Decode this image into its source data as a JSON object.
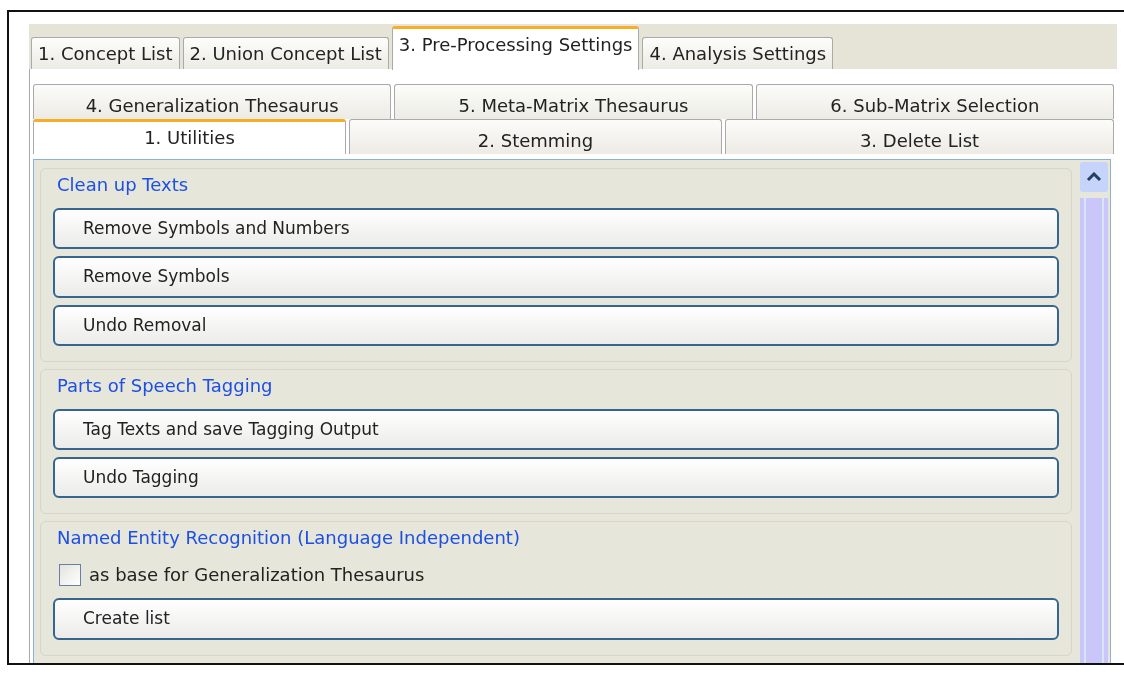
{
  "tabs": [
    {
      "label": "1. Concept List",
      "selected": false
    },
    {
      "label": "2. Union Concept List",
      "selected": false
    },
    {
      "label": "3. Pre-Processing Settings",
      "selected": true
    },
    {
      "label": "4. Analysis Settings",
      "selected": false
    }
  ],
  "subtab_rows": [
    [
      {
        "label": "4. Generalization Thesaurus",
        "selected": false
      },
      {
        "label": "5. Meta-Matrix Thesaurus",
        "selected": false
      },
      {
        "label": "6. Sub-Matrix Selection",
        "selected": false
      }
    ],
    [
      {
        "label": "1. Utilities",
        "selected": true
      },
      {
        "label": "2. Stemming",
        "selected": false
      },
      {
        "label": "3. Delete List",
        "selected": false
      }
    ]
  ],
  "groups": [
    {
      "title": "Clean up Texts",
      "items": [
        {
          "kind": "button",
          "label": "Remove Symbols and Numbers"
        },
        {
          "kind": "button",
          "label": "Remove Symbols"
        },
        {
          "kind": "button",
          "label": "Undo Removal"
        }
      ]
    },
    {
      "title": "Parts of Speech Tagging",
      "items": [
        {
          "kind": "button",
          "label": "Tag Texts and save Tagging Output"
        },
        {
          "kind": "button",
          "label": "Undo Tagging"
        }
      ]
    },
    {
      "title": "Named Entity Recognition (Language Independent)",
      "items": [
        {
          "kind": "checkbox",
          "label": "as base for Generalization Thesaurus",
          "checked": false
        },
        {
          "kind": "button",
          "label": "Create list"
        }
      ]
    }
  ]
}
